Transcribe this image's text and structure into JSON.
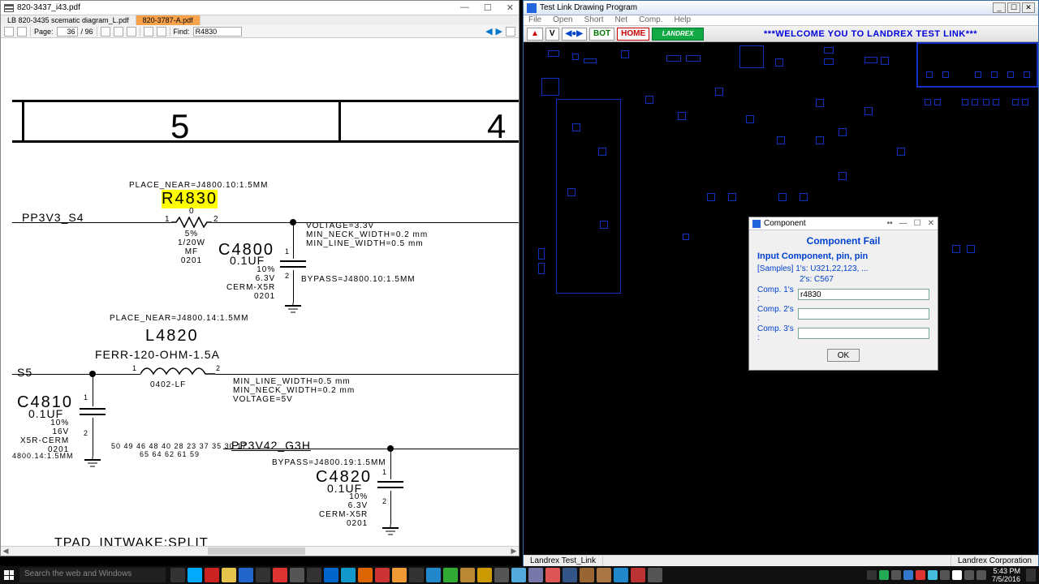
{
  "left": {
    "title": "820-3437_i43.pdf",
    "tabs": [
      "LB 820-3435 scematic diagram_L.pdf",
      "820-3787-A.pdf"
    ],
    "page_label": "Page:",
    "page_cur": "36",
    "page_total": "/ 96",
    "find_label": "Find:",
    "find_value": "R4830",
    "grid": {
      "col5": "5",
      "col4": "4"
    },
    "text": {
      "place_r": "PLACE_NEAR=J4800.10:1.5MM",
      "r4830": "R4830",
      "r_pin1": "1",
      "r_pin2": "2",
      "r_mid": "0",
      "r_specs": "5%\n1/20W\nMF\n0201",
      "pp3v3": "PP3V3_S4",
      "voltblk": "VOLTAGE=3.3V\nMIN_NECK_WIDTH=0.2 mm\nMIN_LINE_WIDTH=0.5 mm",
      "c4800": "C4800",
      "c4800v": "0.1UF",
      "c4800s": "10%\n6.3V\nCERM-X5R\n0201",
      "c4800_p1": "1",
      "c4800_p2": "2",
      "bypass1": "BYPASS=J4800.10:1.5MM",
      "place_l": "PLACE_NEAR=J4800.14:1.5MM",
      "l4820": "L4820",
      "l4820d": "FERR-120-OHM-1.5A",
      "l4820p": "0402-LF",
      "l_p1": "1",
      "l_p2": "2",
      "s5": "S5",
      "minblk2": "MIN_LINE_WIDTH=0.5 mm\nMIN_NECK_WIDTH=0.2 mm\nVOLTAGE=5V",
      "c4810": "C4810",
      "c4810v": "0.1UF",
      "c4810s": "10%\n16V\nX5R-CERM\n0201",
      "c4810_p1": "1",
      "c4810_p2": "2",
      "pins": "50 49 46 48 40 28 23 37 35 30 17\n          65 64 62 61 59",
      "bypass_c4810": "4800.14:1.5MM",
      "pp3v42": "PP3V42_G3H",
      "bypass2": "BYPASS=J4800.19:1.5MM",
      "c4820": "C4820",
      "c4820v": "0.1UF",
      "c4820s": "10%\n6.3V\nCERM-X5R\n0201",
      "c4820_p1": "1",
      "c4820_p2": "2",
      "tpad": "TPAD_INTWAKE:SPLIT"
    }
  },
  "right": {
    "title": "Test Link Drawing Program",
    "menu": [
      "File",
      "Open",
      "Short",
      "Net",
      "Comp.",
      "Help"
    ],
    "tool": {
      "v": "V",
      "bot": "BOT",
      "home": "HOME",
      "logo": "LANDREX"
    },
    "marquee": "***WELCOME YOU TO LANDREX TEST LINK***",
    "status_l": "Landrex Test_Link",
    "status_r": "Landrex Corporation",
    "dialog": {
      "title": "Component",
      "header": "Component Fail",
      "sub": "Input Component, pin, pin",
      "samp1": "[Samples] 1's: U321,22,123, ...",
      "samp2": "2's: C567",
      "c1": "Comp. 1's :",
      "c1v": "r4830",
      "c2": "Comp. 2's :",
      "c2v": "",
      "c3": "Comp. 3's :",
      "c3v": "",
      "ok": "OK"
    }
  },
  "taskbar": {
    "search": "Search the web and Windows",
    "time": "5:43 PM",
    "date": "7/5/2016"
  }
}
